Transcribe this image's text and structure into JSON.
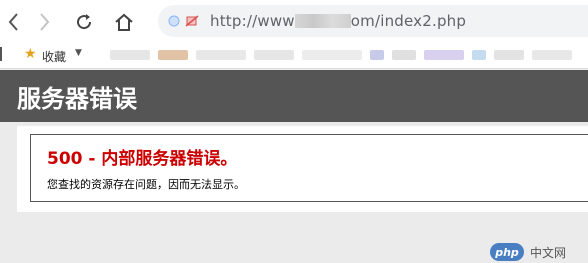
{
  "browser": {
    "url_visible_start": "http://www",
    "url_visible_end": "om/index2.php"
  },
  "bookmarks": {
    "favorites_label": "收藏"
  },
  "page": {
    "header_title": "服务器错误",
    "error_title": "500 - 内部服务器错误。",
    "error_message": "您查找的资源存在问题，因而无法显示。"
  },
  "watermark": {
    "logo": "php",
    "text": "中文网"
  },
  "colors": {
    "header_bg": "#555555",
    "error_title": "#cc0000",
    "page_bg": "#ebebeb"
  }
}
